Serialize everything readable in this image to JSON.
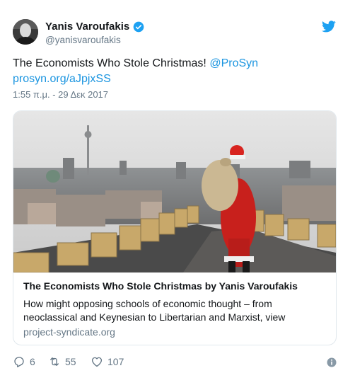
{
  "author": {
    "name": "Yanis Varoufakis",
    "handle": "@yanisvaroufakis"
  },
  "tweet": {
    "text": "The Economists Who Stole Christmas!",
    "mention": "@ProSyn",
    "link": "prosyn.org/aJpjxSS",
    "timestamp": "1:55 π.μ. - 29 Δεκ 2017"
  },
  "card": {
    "title": "The Economists Who Stole Christmas by Yanis Varoufakis",
    "description": "How might opposing schools of economic thought – from neoclassical and Keynesian to Libertarian and Marxist, view",
    "domain": "project-syndicate.org"
  },
  "actions": {
    "replies": "6",
    "retweets": "55",
    "likes": "107"
  },
  "colors": {
    "link": "#1b95e0",
    "secondary_text": "#657786",
    "border": "#e1e8ed",
    "verified_badge": "#1da1f2",
    "twitter_brand": "#1da1f2"
  },
  "icons": [
    "verified-badge-icon",
    "twitter-bird-icon",
    "reply-icon",
    "retweet-icon",
    "like-icon",
    "info-icon"
  ]
}
